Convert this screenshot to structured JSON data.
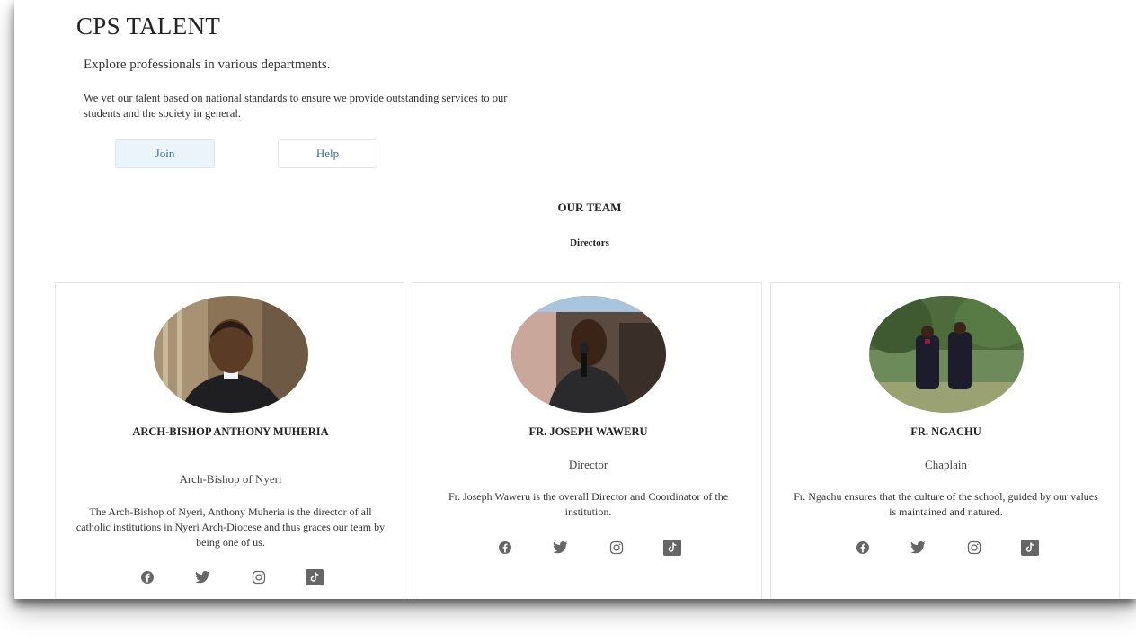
{
  "header": {
    "title": "CPS TALENT",
    "tagline": "Explore professionals in various departments.",
    "description": "We vet our talent based on national standards to ensure we provide outstanding services to our students and the society in general."
  },
  "buttons": {
    "join": "Join",
    "help": "Help"
  },
  "team": {
    "title": "OUR TEAM",
    "subtitle": "Directors",
    "members": [
      {
        "name": "ARCH-BISHOP ANTHONY MUHERIA",
        "role": "Arch-Bishop of Nyeri",
        "bio": "The Arch-Bishop of Nyeri, Anthony Muheria is the director of all catholic institutions in Nyeri Arch-Diocese and thus graces our team by being one of us."
      },
      {
        "name": "FR. JOSEPH WAWERU",
        "role": "Director",
        "bio": "Fr. Joseph Waweru is the overall Director and Coordinator of the institution."
      },
      {
        "name": "FR. NGACHU",
        "role": "Chaplain",
        "bio": "Fr. Ngachu ensures that the culture of the school, guided by our values is maintained and natured."
      }
    ]
  },
  "social_icons": [
    "facebook-icon",
    "twitter-icon",
    "instagram-icon",
    "tiktok-icon"
  ],
  "colors": {
    "button_text": "#3c6e8f",
    "join_bg": "#ebf4fb",
    "icon": "#666666"
  }
}
